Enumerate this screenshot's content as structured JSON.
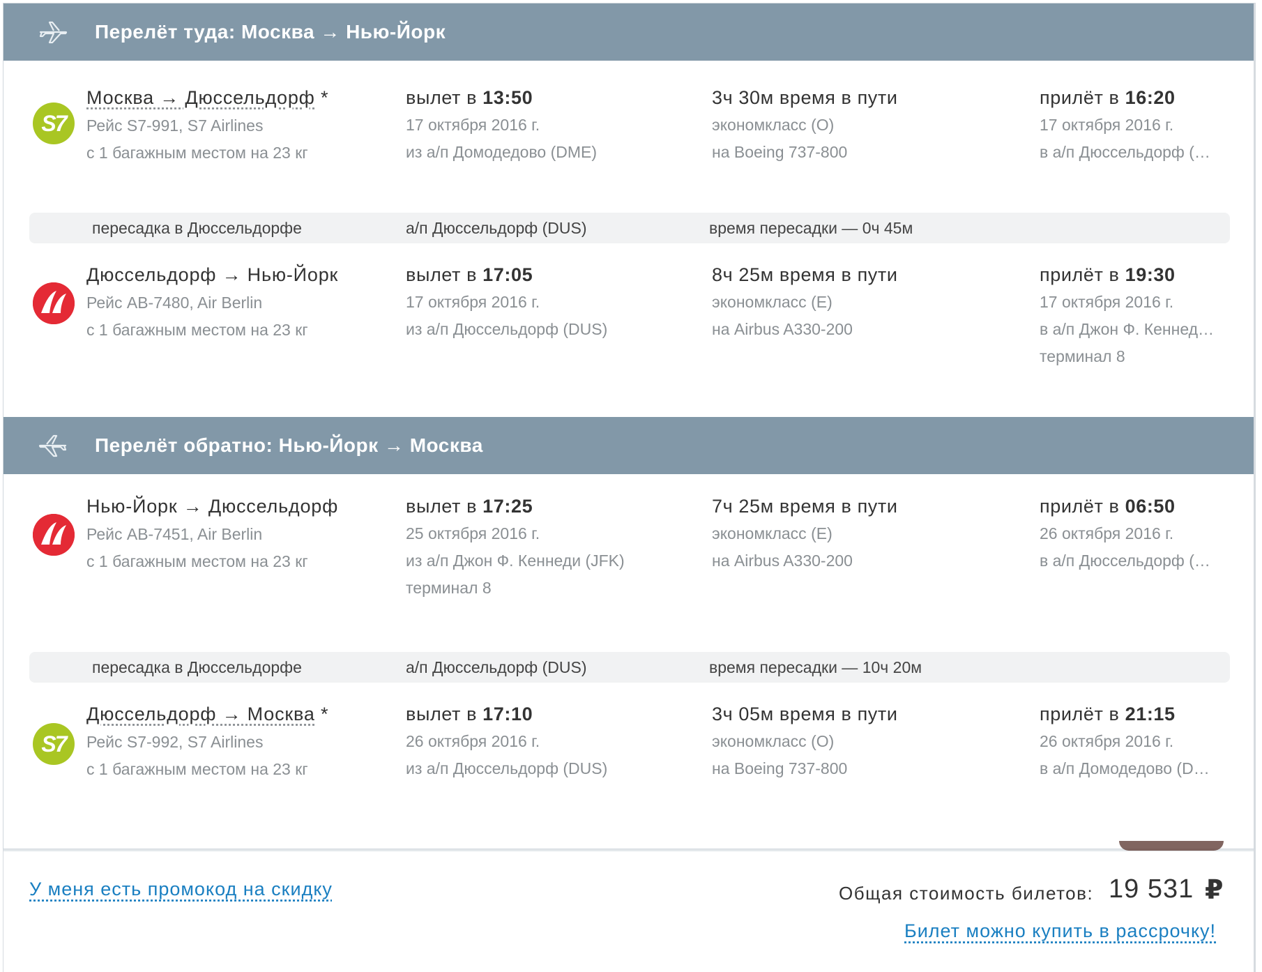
{
  "outbound": {
    "title": "Перелёт туда: Москва → Нью-Йорк",
    "segments": [
      {
        "airline_logo": "s7-logo",
        "route": "Москва → Дюссельдорф",
        "route_mark": " *",
        "flight": "Рейс S7-991, S7 Airlines",
        "baggage": "с 1  багажным местом на 23 кг",
        "dep_label": "вылет в ",
        "dep_time": "13:50",
        "dep_date": "17 октября 2016 г.",
        "dep_airport": "из а/п Домодедово (DME)",
        "dep_terminal": "",
        "duration": "3ч 30м время в пути",
        "class": "экономкласс (O)",
        "aircraft": "на Boeing 737-800",
        "arr_label": "прилёт в ",
        "arr_time": "16:20",
        "arr_date": "17 октября 2016 г.",
        "arr_airport": "в а/п Дюссельдорф (DUS)",
        "arr_terminal": ""
      },
      {
        "airline_logo": "airberlin-logo",
        "route": "Дюссельдорф → Нью-Йорк",
        "route_mark": "",
        "flight": "Рейс AB-7480, Air Berlin",
        "baggage": "с 1  багажным местом на 23 кг",
        "dep_label": "вылет в ",
        "dep_time": "17:05",
        "dep_date": "17 октября 2016 г.",
        "dep_airport": "из а/п Дюссельдорф (DUS)",
        "dep_terminal": "",
        "duration": "8ч 25м время в пути",
        "class": "экономкласс (E)",
        "aircraft": "на Airbus A330-200",
        "arr_label": "прилёт в ",
        "arr_time": "19:30",
        "arr_date": "17 октября 2016 г.",
        "arr_airport": "в а/п Джон Ф. Кеннеди (JFK)",
        "arr_terminal": "терминал 8"
      }
    ],
    "transfer": {
      "city": "пересадка в Дюссельдорфе",
      "airport": "а/п Дюссельдорф (DUS)",
      "time": "время пересадки — 0ч 45м"
    }
  },
  "inbound": {
    "title": "Перелёт обратно: Нью-Йорк → Москва",
    "segments": [
      {
        "airline_logo": "airberlin-logo",
        "route": "Нью-Йорк → Дюссельдорф",
        "route_mark": "",
        "flight": "Рейс AB-7451, Air Berlin",
        "baggage": "с 1  багажным местом на 23 кг",
        "dep_label": "вылет в ",
        "dep_time": "17:25",
        "dep_date": "25 октября 2016 г.",
        "dep_airport": "из а/п Джон Ф. Кеннеди (JFK)",
        "dep_terminal": "терминал 8",
        "duration": "7ч 25м время в пути",
        "class": "экономкласс (E)",
        "aircraft": "на Airbus A330-200",
        "arr_label": "прилёт в ",
        "arr_time": "06:50",
        "arr_date": "26 октября 2016 г.",
        "arr_airport": "в а/п Дюссельдорф (DUS)",
        "arr_terminal": ""
      },
      {
        "airline_logo": "s7-logo",
        "route": "Дюссельдорф → Москва",
        "route_mark": " *",
        "flight": "Рейс S7-992, S7 Airlines",
        "baggage": "с 1  багажным местом на 23 кг",
        "dep_label": "вылет в ",
        "dep_time": "17:10",
        "dep_date": "26 октября 2016 г.",
        "dep_airport": "из а/п Дюссельдорф (DUS)",
        "dep_terminal": "",
        "duration": "3ч 05м время в пути",
        "class": "экономкласс (O)",
        "aircraft": "на Boeing 737-800",
        "arr_label": "прилёт в ",
        "arr_time": "21:15",
        "arr_date": "26 октября 2016 г.",
        "arr_airport": "в а/п Домодедово (DME)",
        "arr_terminal": ""
      }
    ],
    "transfer": {
      "city": "пересадка в Дюссельдорфе",
      "airport": "а/п Дюссельдорф (DUS)",
      "time": "время пересадки — 10ч 20м"
    }
  },
  "footer": {
    "promo_link": "У меня есть промокод на скидку",
    "total_label": "Общая стоимость билетов:",
    "total_value": "19 531",
    "currency": "₽",
    "installment_link": "Билет можно купить в рассрочку!"
  },
  "colors": {
    "header_bg": "#8298a8",
    "link": "#1a7fc1",
    "s7": "#a9c623",
    "airberlin": "#e42a35"
  }
}
